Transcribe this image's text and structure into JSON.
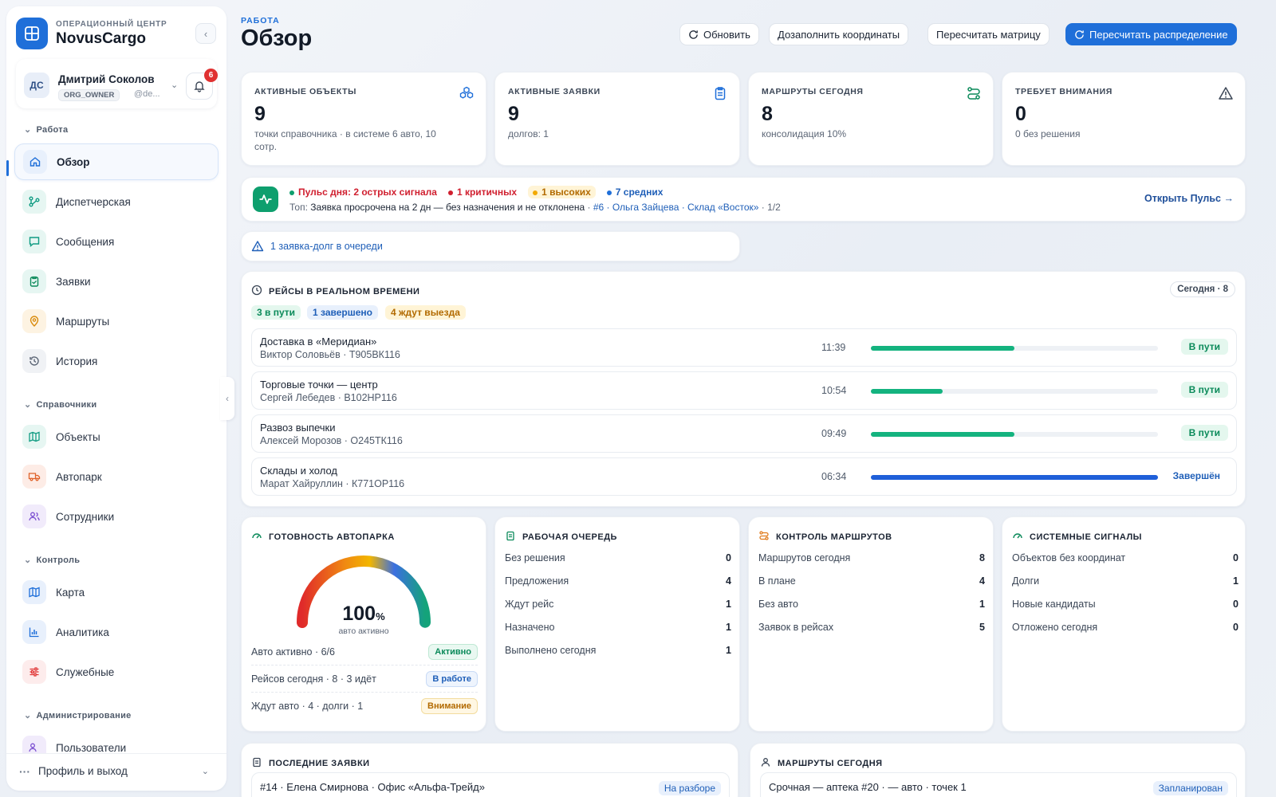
{
  "brand": {
    "subtitle": "ОПЕРАЦИОННЫЙ ЦЕНТР",
    "name": "NovusCargo"
  },
  "user": {
    "initials": "ДС",
    "name": "Дмитрий Соколов",
    "role": "ORG_OWNER",
    "handle": "@de...",
    "notifications": "6"
  },
  "sidebar": {
    "sections": [
      "Работа",
      "Справочники",
      "Контроль",
      "Администрирование"
    ],
    "work": [
      {
        "label": "Обзор",
        "icon": "home-icon"
      },
      {
        "label": "Диспетчерская",
        "icon": "dispatch-icon"
      },
      {
        "label": "Сообщения",
        "icon": "message-icon"
      },
      {
        "label": "Заявки",
        "icon": "clipboard-icon"
      },
      {
        "label": "Маршруты",
        "icon": "map-pin-icon"
      },
      {
        "label": "История",
        "icon": "history-icon"
      }
    ],
    "refs": [
      {
        "label": "Объекты",
        "icon": "map-icon"
      },
      {
        "label": "Автопарк",
        "icon": "truck-icon"
      },
      {
        "label": "Сотрудники",
        "icon": "users-icon"
      }
    ],
    "control": [
      {
        "label": "Карта",
        "icon": "map-icon"
      },
      {
        "label": "Аналитика",
        "icon": "chart-icon"
      },
      {
        "label": "Служебные",
        "icon": "sliders-icon"
      }
    ],
    "admin": [
      {
        "label": "Пользователи",
        "icon": "users-icon"
      }
    ],
    "profile": "Профиль и выход"
  },
  "header": {
    "kicker": "РАБОТА",
    "title": "Обзор",
    "buttons": {
      "refresh": "Обновить",
      "fill_coords": "Дозаполнить координаты",
      "recalc_matrix": "Пересчитать матрицу",
      "recalc_dist": "Пересчитать распределение"
    }
  },
  "kpis": [
    {
      "label": "АКТИВНЫЕ ОБЪЕКТЫ",
      "value": "9",
      "sub": "точки справочника · в системе 6 авто, 10 сотр.",
      "icon": "objects-icon"
    },
    {
      "label": "АКТИВНЫЕ ЗАЯВКИ",
      "value": "9",
      "sub": "долгов: 1",
      "icon": "clipboard-icon"
    },
    {
      "label": "МАРШРУТЫ СЕГОДНЯ",
      "value": "8",
      "sub": "консолидация 10%",
      "icon": "route-icon"
    },
    {
      "label": "ТРЕБУЕТ ВНИМАНИЯ",
      "value": "0",
      "sub": "0 без решения",
      "icon": "warning-icon"
    }
  ],
  "pulse": {
    "title": "Пульс дня: 2 острых сигнала",
    "critical": "1 критичных",
    "high": "1 высоких",
    "medium": "7 средних",
    "top_prefix": "Топ:",
    "top_text": "Заявка просрочена на 2 дн — без назначения и не отклонена",
    "top_link": "#6 · Ольга Зайцева · Склад «Восток»",
    "top_page": "· 1/2",
    "open": "Открыть Пульс"
  },
  "debt": {
    "text": "1 заявка-долг в очереди"
  },
  "trips": {
    "title": "РЕЙСЫ В РЕАЛЬНОМ ВРЕМЕНИ",
    "today": "Сегодня · 8",
    "chips": {
      "en_route": "3 в пути",
      "done": "1 завершено",
      "waiting": "4 ждут выезда"
    },
    "rows": [
      {
        "name": "Доставка в «Меридиан»",
        "sub": "Виктор Соловьёв · Т905ВК116",
        "time": "11:39",
        "progress": 0.5,
        "status": "В пути",
        "kind": "go"
      },
      {
        "name": "Торговые точки — центр",
        "sub": "Сергей Лебедев · В102НР116",
        "time": "10:54",
        "progress": 0.25,
        "status": "В пути",
        "kind": "go"
      },
      {
        "name": "Развоз выпечки",
        "sub": "Алексей Морозов · О245ТК116",
        "time": "09:49",
        "progress": 0.5,
        "status": "В пути",
        "kind": "go"
      },
      {
        "name": "Склады и холод",
        "sub": "Марат Хайруллин · К771ОР116",
        "time": "06:34",
        "progress": 1.0,
        "status": "Завершён",
        "kind": "done"
      }
    ]
  },
  "fleet": {
    "title": "ГОТОВНОСТЬ АВТОПАРКА",
    "percent": "100",
    "percent_sign": "%",
    "percent_value": 1.0,
    "sub": "авто активно",
    "rows": [
      {
        "label": "Авто активно · 6/6",
        "badge": "Активно"
      },
      {
        "label": "Рейсов сегодня · 8 · 3 идёт",
        "badge": "В работе"
      },
      {
        "label": "Ждут авто · 4 · долги · 1",
        "badge": "Внимание"
      }
    ]
  },
  "queue": {
    "title": "РАБОЧАЯ ОЧЕРЕДЬ",
    "rows": [
      {
        "label": "Без решения",
        "value": "0"
      },
      {
        "label": "Предложения",
        "value": "4"
      },
      {
        "label": "Ждут рейс",
        "value": "1"
      },
      {
        "label": "Назначено",
        "value": "1"
      },
      {
        "label": "Выполнено сегодня",
        "value": "1"
      }
    ]
  },
  "route_control": {
    "title": "КОНТРОЛЬ МАРШРУТОВ",
    "rows": [
      {
        "label": "Маршрутов сегодня",
        "value": "8"
      },
      {
        "label": "В плане",
        "value": "4"
      },
      {
        "label": "Без авто",
        "value": "1"
      },
      {
        "label": "Заявок в рейсах",
        "value": "5"
      }
    ]
  },
  "signals": {
    "title": "СИСТЕМНЫЕ СИГНАЛЫ",
    "rows": [
      {
        "label": "Объектов без координат",
        "value": "0"
      },
      {
        "label": "Долги",
        "value": "1"
      },
      {
        "label": "Новые кандидаты",
        "value": "0"
      },
      {
        "label": "Отложено сегодня",
        "value": "0"
      }
    ]
  },
  "recent": {
    "title": "ПОСЛЕДНИЕ ЗАЯВКИ",
    "row": "#14 · Елена Смирнова · Офис «Альфа-Трейд»",
    "badge": "На разборе"
  },
  "routes_today": {
    "title": "МАРШРУТЫ СЕГОДНЯ",
    "row": "Срочная — аптека #20 · — авто · точек 1",
    "badge": "Запланирован"
  },
  "colors": {
    "accent": "#1f6fd9",
    "success": "#0b8a5a",
    "danger": "#e03131",
    "warning": "#b26a00"
  }
}
